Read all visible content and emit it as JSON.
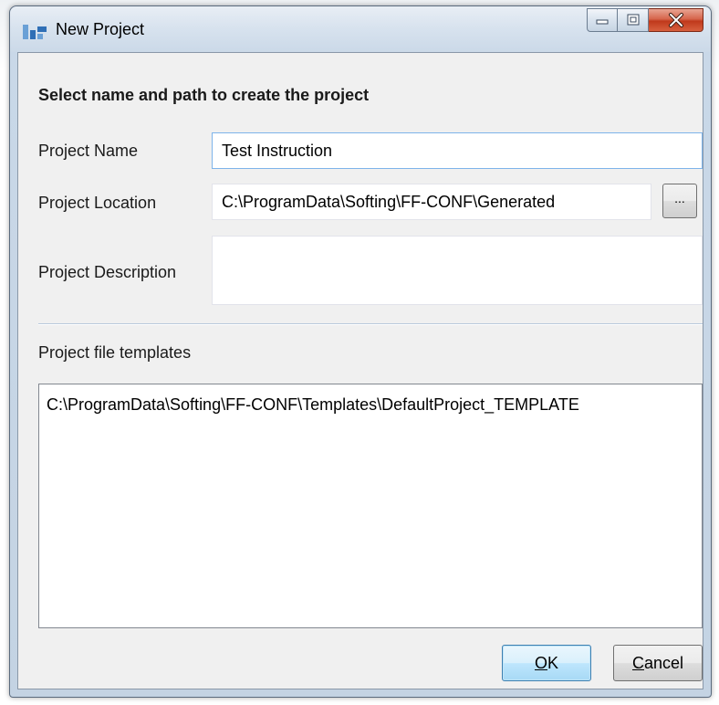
{
  "window": {
    "title": "New Project",
    "app_icon": "app-icon"
  },
  "caption_buttons": {
    "minimize_icon": "minimize-icon",
    "maximize_icon": "maximize-icon",
    "close_icon": "close-icon"
  },
  "form": {
    "heading": "Select name and path to create the project",
    "project_name": {
      "label": "Project Name",
      "value": "Test Instruction"
    },
    "project_location": {
      "label": "Project Location",
      "value": "C:\\ProgramData\\Softing\\FF-CONF\\Generated",
      "browse_label": "..."
    },
    "project_description": {
      "label": "Project Description",
      "value": ""
    },
    "templates": {
      "label": "Project file templates",
      "items": [
        "C:\\ProgramData\\Softing\\FF-CONF\\Templates\\DefaultProject_TEMPLATE"
      ]
    }
  },
  "buttons": {
    "ok": "OK",
    "cancel": "Cancel"
  },
  "colors": {
    "focus_border": "#7eb4ea",
    "close_button": "#c0391c",
    "default_button_border": "#3c7fb1"
  }
}
